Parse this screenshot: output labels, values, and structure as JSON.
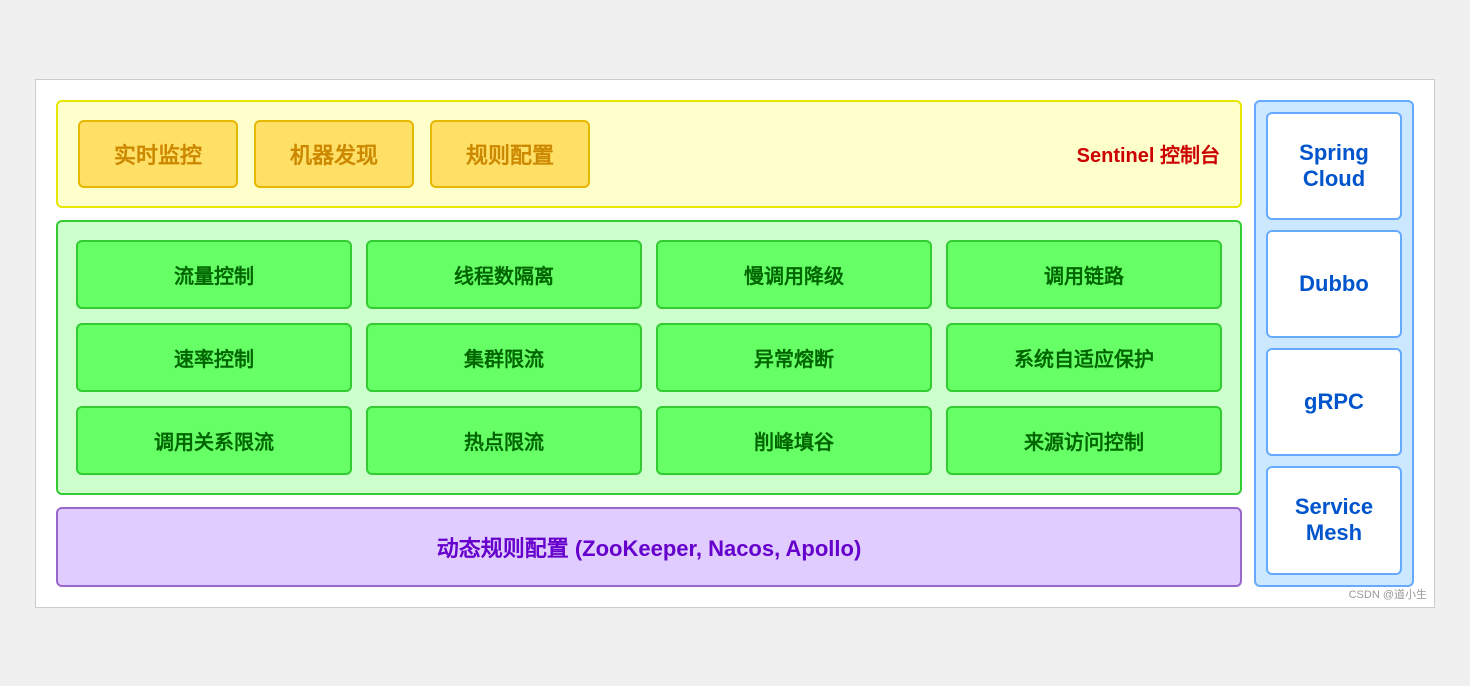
{
  "sentinel": {
    "boxes": [
      "实时监控",
      "机器发现",
      "规则配置"
    ],
    "label": "Sentinel 控制台"
  },
  "features": [
    "流量控制",
    "线程数隔离",
    "慢调用降级",
    "调用链路",
    "速率控制",
    "集群限流",
    "异常熔断",
    "系统自适应保护",
    "调用关系限流",
    "热点限流",
    "削峰填谷",
    "来源访问控制"
  ],
  "dynamic": {
    "label": "动态规则配置 (ZooKeeper, Nacos, Apollo)"
  },
  "sidebar": {
    "items": [
      "Spring Cloud",
      "Dubbo",
      "gRPC",
      "Service Mesh"
    ]
  },
  "watermark": "CSDN @道小生"
}
